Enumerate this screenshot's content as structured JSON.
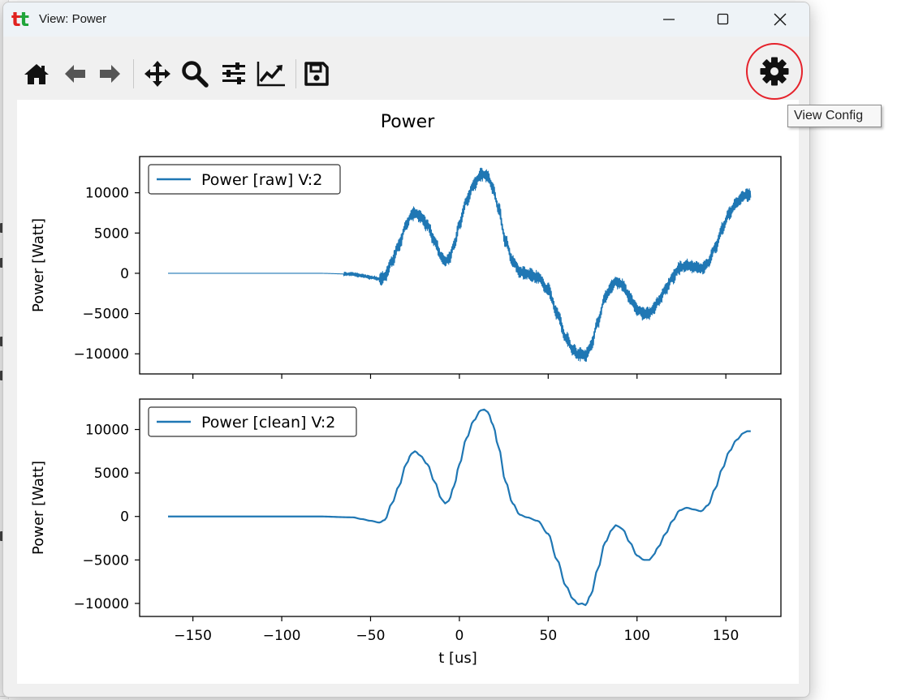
{
  "window": {
    "title": "View: Power",
    "logo_letters": [
      "t",
      "t"
    ]
  },
  "window_controls": [
    "minimize",
    "maximize",
    "close"
  ],
  "toolbar": {
    "tools": [
      {
        "name": "home-icon",
        "tooltip": "Home"
      },
      {
        "name": "back-icon",
        "tooltip": "Back"
      },
      {
        "name": "forward-icon",
        "tooltip": "Forward"
      },
      {
        "name": "pan-icon",
        "tooltip": "Pan"
      },
      {
        "name": "zoom-icon",
        "tooltip": "Zoom"
      },
      {
        "name": "subplots-config-icon",
        "tooltip": "Configure subplots"
      },
      {
        "name": "axes-edit-icon",
        "tooltip": "Edit axes"
      },
      {
        "name": "save-icon",
        "tooltip": "Save"
      }
    ],
    "config_button_icon": "gear-icon",
    "config_tooltip": "View Config"
  },
  "colors": {
    "series": "#1f77b4",
    "highlight_ring": "#e5222b"
  },
  "chart_data": {
    "type": "line",
    "title": "Power",
    "xlabel": "t [us]",
    "xlim": [
      -180,
      181
    ],
    "x_ticks": [
      -150,
      -100,
      -50,
      0,
      50,
      100,
      150
    ],
    "x_tick_labels": [
      "−150",
      "−100",
      "−50",
      "0",
      "50",
      "100",
      "150"
    ],
    "subplots": [
      {
        "ylabel": "Power [Watt]",
        "ylim": [
          -12500,
          14500
        ],
        "y_ticks": [
          -10000,
          -5000,
          0,
          5000,
          10000
        ],
        "y_tick_labels": [
          "−10000",
          "−5000",
          "0",
          "5000",
          "10000"
        ],
        "legend": "Power [raw] V:2",
        "legend_loc": "upper left",
        "noise_band": 900,
        "series": [
          {
            "name": "Power [raw] V:2"
          }
        ]
      },
      {
        "ylabel": "Power [Watt]",
        "ylim": [
          -11500,
          13500
        ],
        "y_ticks": [
          -10000,
          -5000,
          0,
          5000,
          10000
        ],
        "y_tick_labels": [
          "−10000",
          "−5000",
          "0",
          "5000",
          "10000"
        ],
        "legend": "Power [clean] V:2",
        "legend_loc": "upper left",
        "noise_band": 0,
        "series": [
          {
            "name": "Power [clean] V:2"
          }
        ]
      }
    ],
    "x": [
      -164,
      -120,
      -80,
      -60,
      -55,
      -50,
      -45,
      -42,
      -38,
      -34,
      -30,
      -27,
      -25,
      -22,
      -18,
      -14,
      -10,
      -8,
      -6,
      -3,
      0,
      4,
      8,
      12,
      14,
      16,
      19,
      22,
      26,
      30,
      34,
      38,
      44,
      50,
      55,
      60,
      64,
      67,
      69,
      71,
      74,
      78,
      82,
      86,
      88,
      90,
      92,
      96,
      100,
      104,
      107,
      109,
      112,
      116,
      120,
      124,
      128,
      132,
      136,
      140,
      144,
      148,
      152,
      156,
      160,
      162,
      164
    ],
    "y": [
      0,
      0,
      0,
      -100,
      -300,
      -500,
      -700,
      -400,
      1500,
      3500,
      6000,
      7200,
      7500,
      7000,
      6000,
      4000,
      2000,
      1500,
      1800,
      3500,
      6000,
      9000,
      11000,
      12200,
      12300,
      12000,
      10500,
      8000,
      4000,
      1500,
      200,
      -100,
      -500,
      -2000,
      -5000,
      -8000,
      -9500,
      -10100,
      -10000,
      -10200,
      -9000,
      -6000,
      -3000,
      -1500,
      -1000,
      -1200,
      -1500,
      -3000,
      -4500,
      -5000,
      -5000,
      -4500,
      -3500,
      -2000,
      -500,
      700,
      1000,
      800,
      600,
      1300,
      3200,
      5500,
      7500,
      8800,
      9600,
      9800,
      9800
    ]
  }
}
